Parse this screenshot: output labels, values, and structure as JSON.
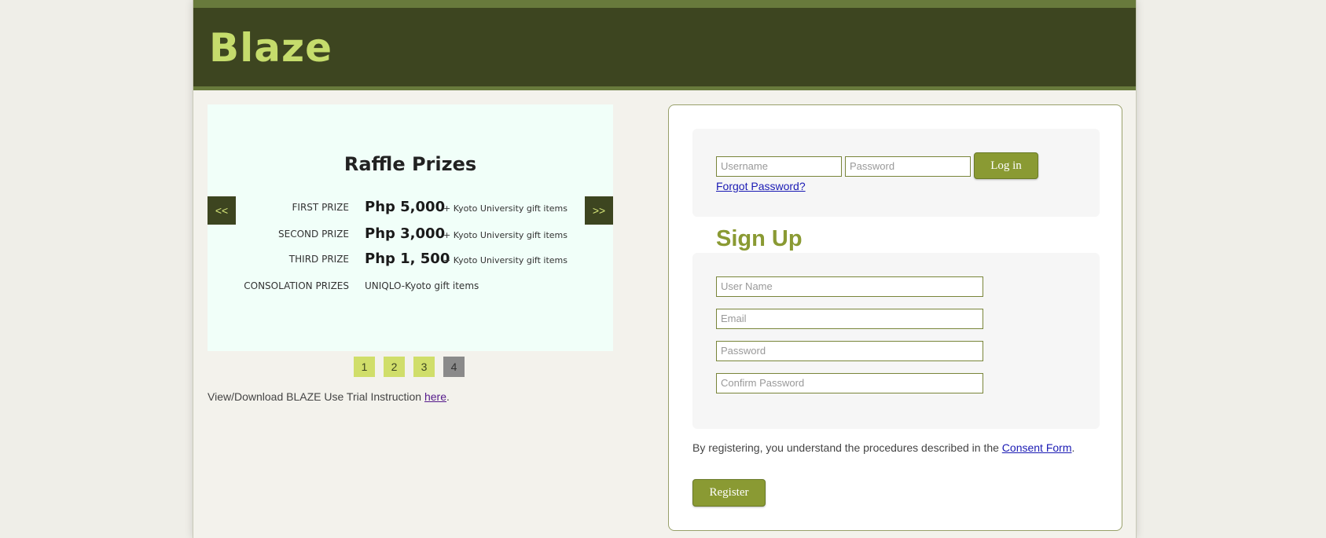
{
  "header": {
    "logo": "Blaze"
  },
  "slideshow": {
    "title": "Raffle Prizes",
    "prizes": [
      {
        "label": "FIRST PRIZE",
        "amount": "Php 5,000",
        "extra": "+ Kyoto University gift items"
      },
      {
        "label": "SECOND PRIZE",
        "amount": "Php 3,000",
        "extra": "+ Kyoto University gift items"
      },
      {
        "label": "THIRD PRIZE",
        "amount": "Php 1, 500",
        "extra": "+ Kyoto University gift items"
      },
      {
        "label": "CONSOLATION PRIZES",
        "amount": "",
        "extra": "UNIQLO-Kyoto gift items"
      }
    ],
    "prev_label": "<<",
    "next_label": ">>",
    "pages": [
      "1",
      "2",
      "3",
      "4"
    ],
    "active_page": "4"
  },
  "trial": {
    "text": "View/Download BLAZE Use Trial Instruction ",
    "link": "here",
    "suffix": "."
  },
  "login": {
    "username_placeholder": "Username",
    "password_placeholder": "Password",
    "login_button": "Log in",
    "forgot_link": "Forgot Password?"
  },
  "signup": {
    "title": "Sign Up",
    "username_placeholder": "User Name",
    "email_placeholder": "Email",
    "password_placeholder": "Password",
    "confirm_placeholder": "Confirm Password",
    "consent_text": "By registering, you understand the procedures described in the ",
    "consent_link": "Consent Form",
    "consent_suffix": ".",
    "register_button": "Register"
  },
  "colors": {
    "header": "#3d4520",
    "accent": "#8a9a33",
    "logo": "#c5dc6c"
  }
}
